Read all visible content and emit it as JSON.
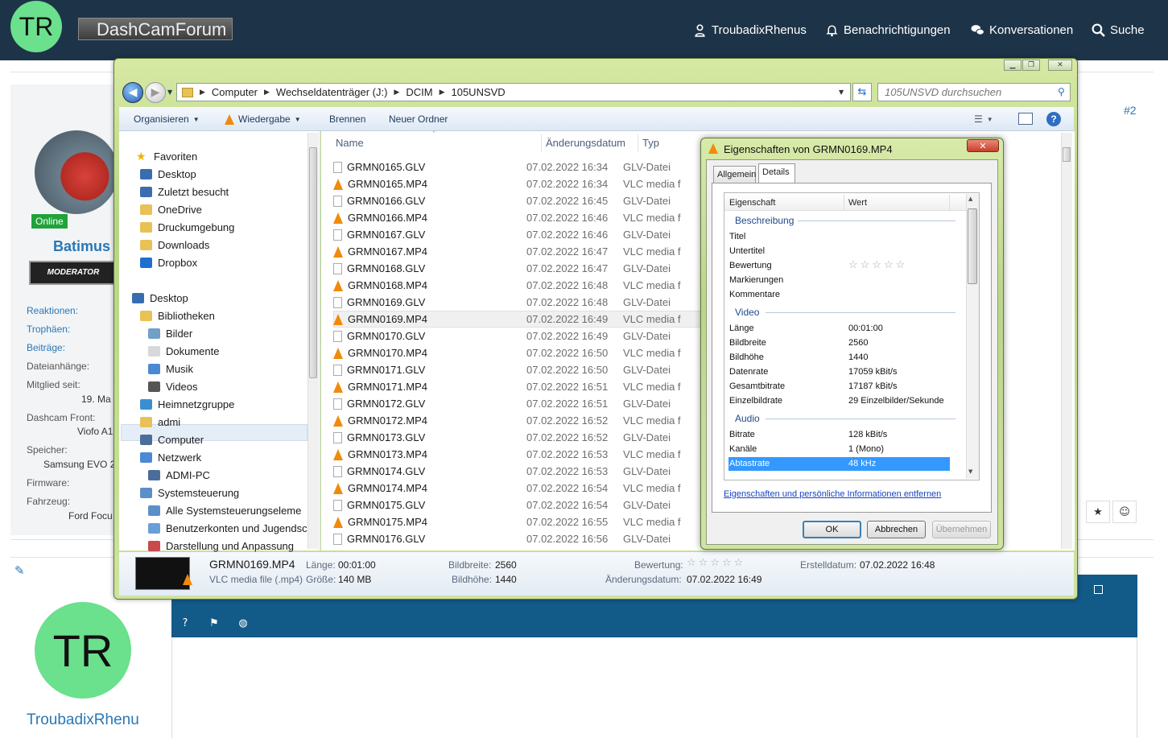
{
  "forum": {
    "avatar_initials": "TR",
    "logo_text": "DashCamForum",
    "nav": {
      "user": "TroubadixRhenus",
      "notifications": "Benachrichtigungen",
      "conversations": "Konversationen",
      "search": "Suche"
    },
    "post_number": "#2",
    "poster": {
      "online_badge": "Online",
      "name": "Batimus",
      "role_badge": "MODERATOR",
      "stats": [
        {
          "label": "Reaktionen:",
          "value": ""
        },
        {
          "label": "Trophäen:",
          "value": ""
        },
        {
          "label": "Beiträge:",
          "value": ""
        },
        {
          "label": "Dateianhänge:",
          "value": ""
        },
        {
          "label": "Mitglied seit:",
          "value": "19. Ma"
        },
        {
          "label": "Dashcam Front:",
          "value": "Viofo A1"
        },
        {
          "label": "Speicher:",
          "value": "Samsung EVO 2"
        },
        {
          "label": "Firmware:",
          "value": ""
        },
        {
          "label": "Fahrzeug:",
          "value": "Ford Focu"
        }
      ]
    },
    "reply_user": "TroubadixRhenus",
    "reply_avatar_initials": "TR",
    "colors": {
      "header": "#1d3448",
      "avatar": "#6be08d",
      "link": "#2a77b4",
      "editor_bar": "#125a87"
    }
  },
  "explorer": {
    "breadcrumb": [
      "Computer",
      "Wechseldatenträger (J:)",
      "DCIM",
      "105UNSVD"
    ],
    "search_placeholder": "105UNSVD durchsuchen",
    "toolbar": {
      "organize": "Organisieren",
      "play": "Wiedergabe",
      "burn": "Brennen",
      "new_folder": "Neuer Ordner"
    },
    "nav_items": [
      {
        "label": "Favoriten",
        "icon": "star-icon"
      },
      {
        "label": "Desktop",
        "icon": "desktop-icon"
      },
      {
        "label": "Zuletzt besucht",
        "icon": "recent-places-icon"
      },
      {
        "label": "OneDrive",
        "icon": "folder-icon"
      },
      {
        "label": "Druckumgebung",
        "icon": "folder-icon"
      },
      {
        "label": "Downloads",
        "icon": "downloads-folder-icon"
      },
      {
        "label": "Dropbox",
        "icon": "dropbox-icon"
      },
      {
        "label": "Desktop",
        "icon": "desktop-icon"
      },
      {
        "label": "Bibliotheken",
        "icon": "libraries-icon"
      },
      {
        "label": "Bilder",
        "icon": "pictures-icon"
      },
      {
        "label": "Dokumente",
        "icon": "documents-icon"
      },
      {
        "label": "Musik",
        "icon": "music-icon"
      },
      {
        "label": "Videos",
        "icon": "videos-icon"
      },
      {
        "label": "Heimnetzgruppe",
        "icon": "homegroup-icon"
      },
      {
        "label": "admi",
        "icon": "user-folder-icon"
      },
      {
        "label": "Computer",
        "icon": "computer-icon"
      },
      {
        "label": "Netzwerk",
        "icon": "network-icon"
      },
      {
        "label": "ADMI-PC",
        "icon": "pc-icon"
      },
      {
        "label": "Systemsteuerung",
        "icon": "control-panel-icon"
      },
      {
        "label": "Alle Systemsteuerungseleme",
        "icon": "control-panel-icon"
      },
      {
        "label": "Benutzerkonten und Jugendsc",
        "icon": "user-accounts-icon"
      },
      {
        "label": "Darstellung und Anpassung",
        "icon": "appearance-icon"
      }
    ],
    "columns": {
      "name": "Name",
      "date": "Änderungsdatum",
      "type": "Typ"
    },
    "files": [
      {
        "name": "GRMN0165.GLV",
        "date": "07.02.2022 16:34",
        "type": "GLV-Datei",
        "kind": "doc"
      },
      {
        "name": "GRMN0165.MP4",
        "date": "07.02.2022 16:34",
        "type": "VLC media f",
        "kind": "vlc"
      },
      {
        "name": "GRMN0166.GLV",
        "date": "07.02.2022 16:45",
        "type": "GLV-Datei",
        "kind": "doc"
      },
      {
        "name": "GRMN0166.MP4",
        "date": "07.02.2022 16:46",
        "type": "VLC media f",
        "kind": "vlc"
      },
      {
        "name": "GRMN0167.GLV",
        "date": "07.02.2022 16:46",
        "type": "GLV-Datei",
        "kind": "doc"
      },
      {
        "name": "GRMN0167.MP4",
        "date": "07.02.2022 16:47",
        "type": "VLC media f",
        "kind": "vlc"
      },
      {
        "name": "GRMN0168.GLV",
        "date": "07.02.2022 16:47",
        "type": "GLV-Datei",
        "kind": "doc"
      },
      {
        "name": "GRMN0168.MP4",
        "date": "07.02.2022 16:48",
        "type": "VLC media f",
        "kind": "vlc"
      },
      {
        "name": "GRMN0169.GLV",
        "date": "07.02.2022 16:48",
        "type": "GLV-Datei",
        "kind": "doc"
      },
      {
        "name": "GRMN0169.MP4",
        "date": "07.02.2022 16:49",
        "type": "VLC media f",
        "kind": "vlc"
      },
      {
        "name": "GRMN0170.GLV",
        "date": "07.02.2022 16:49",
        "type": "GLV-Datei",
        "kind": "doc"
      },
      {
        "name": "GRMN0170.MP4",
        "date": "07.02.2022 16:50",
        "type": "VLC media f",
        "kind": "vlc"
      },
      {
        "name": "GRMN0171.GLV",
        "date": "07.02.2022 16:50",
        "type": "GLV-Datei",
        "kind": "doc"
      },
      {
        "name": "GRMN0171.MP4",
        "date": "07.02.2022 16:51",
        "type": "VLC media f",
        "kind": "vlc"
      },
      {
        "name": "GRMN0172.GLV",
        "date": "07.02.2022 16:51",
        "type": "GLV-Datei",
        "kind": "doc"
      },
      {
        "name": "GRMN0172.MP4",
        "date": "07.02.2022 16:52",
        "type": "VLC media f",
        "kind": "vlc"
      },
      {
        "name": "GRMN0173.GLV",
        "date": "07.02.2022 16:52",
        "type": "GLV-Datei",
        "kind": "doc"
      },
      {
        "name": "GRMN0173.MP4",
        "date": "07.02.2022 16:53",
        "type": "VLC media f",
        "kind": "vlc"
      },
      {
        "name": "GRMN0174.GLV",
        "date": "07.02.2022 16:53",
        "type": "GLV-Datei",
        "kind": "doc"
      },
      {
        "name": "GRMN0174.MP4",
        "date": "07.02.2022 16:54",
        "type": "VLC media f",
        "kind": "vlc"
      },
      {
        "name": "GRMN0175.GLV",
        "date": "07.02.2022 16:54",
        "type": "GLV-Datei",
        "kind": "doc"
      },
      {
        "name": "GRMN0175.MP4",
        "date": "07.02.2022 16:55",
        "type": "VLC media f",
        "kind": "vlc"
      },
      {
        "name": "GRMN0176.GLV",
        "date": "07.02.2022 16:56",
        "type": "GLV-Datei",
        "kind": "doc"
      }
    ],
    "selected_file": "GRMN0169.MP4",
    "details_pane": {
      "name": "GRMN0169.MP4",
      "type": "VLC media file (.mp4)",
      "length_label": "Länge:",
      "length": "00:01:00",
      "size_label": "Größe:",
      "size": "140 MB",
      "width_label": "Bildbreite:",
      "width": "2560",
      "height_label": "Bildhöhe:",
      "height": "1440",
      "rating_label": "Bewertung:",
      "modified_label": "Änderungsdatum:",
      "modified": "07.02.2022 16:49",
      "created_label": "Erstelldatum:",
      "created": "07.02.2022 16:48"
    }
  },
  "dialog": {
    "title": "Eigenschaften von GRMN0169.MP4",
    "tabs": [
      "Allgemein",
      "Details"
    ],
    "active_tab": "Details",
    "columns": {
      "property": "Eigenschaft",
      "value": "Wert"
    },
    "groups": {
      "description": "Beschreibung",
      "video": "Video",
      "audio": "Audio"
    },
    "rows": [
      {
        "p": "Titel",
        "v": ""
      },
      {
        "p": "Untertitel",
        "v": ""
      },
      {
        "p": "Bewertung",
        "v": "☆☆☆☆☆"
      },
      {
        "p": "Markierungen",
        "v": ""
      },
      {
        "p": "Kommentare",
        "v": ""
      },
      {
        "p": "Länge",
        "v": "00:01:00"
      },
      {
        "p": "Bildbreite",
        "v": "2560"
      },
      {
        "p": "Bildhöhe",
        "v": "1440"
      },
      {
        "p": "Datenrate",
        "v": "17059 kBit/s"
      },
      {
        "p": "Gesamtbitrate",
        "v": "17187 kBit/s"
      },
      {
        "p": "Einzelbildrate",
        "v": "29 Einzelbilder/Sekunde"
      },
      {
        "p": "Bitrate",
        "v": "128 kBit/s"
      },
      {
        "p": "Kanäle",
        "v": "1 (Mono)"
      },
      {
        "p": "Abtastrate",
        "v": "48 kHz"
      }
    ],
    "remove_link": "Eigenschaften und persönliche Informationen entfernen",
    "buttons": {
      "ok": "OK",
      "cancel": "Abbrechen",
      "apply": "Übernehmen"
    }
  }
}
